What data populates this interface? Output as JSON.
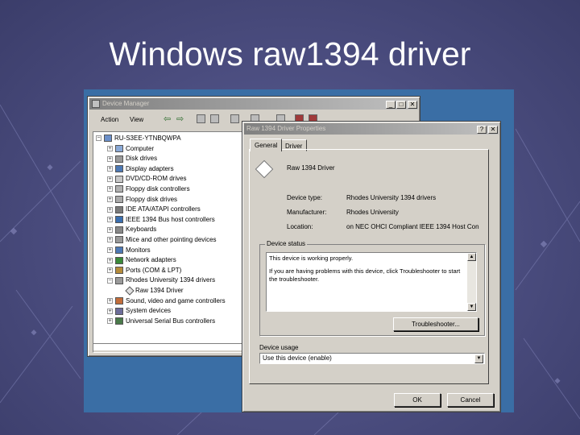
{
  "slide": {
    "title": "Windows raw1394 driver"
  },
  "device_manager": {
    "title": "Device Manager",
    "menus": [
      "Action",
      "View"
    ],
    "tree": [
      {
        "label": "RU-S3EE-YTNBQWPA",
        "level": 0,
        "icon": "computer-root-icon"
      },
      {
        "label": "Computer",
        "level": 1,
        "icon": "computer-icon"
      },
      {
        "label": "Disk drives",
        "level": 1,
        "icon": "disk-drive-icon"
      },
      {
        "label": "Display adapters",
        "level": 1,
        "icon": "display-adapter-icon"
      },
      {
        "label": "DVD/CD-ROM drives",
        "level": 1,
        "icon": "cdrom-icon"
      },
      {
        "label": "Floppy disk controllers",
        "level": 1,
        "icon": "floppy-controller-icon"
      },
      {
        "label": "Floppy disk drives",
        "level": 1,
        "icon": "floppy-drive-icon"
      },
      {
        "label": "IDE ATA/ATAPI controllers",
        "level": 1,
        "icon": "ide-controller-icon"
      },
      {
        "label": "IEEE 1394 Bus host controllers",
        "level": 1,
        "icon": "ieee1394-icon"
      },
      {
        "label": "Keyboards",
        "level": 1,
        "icon": "keyboard-icon"
      },
      {
        "label": "Mice and other pointing devices",
        "level": 1,
        "icon": "mouse-icon"
      },
      {
        "label": "Monitors",
        "level": 1,
        "icon": "monitor-icon"
      },
      {
        "label": "Network adapters",
        "level": 1,
        "icon": "network-adapter-icon"
      },
      {
        "label": "Ports (COM & LPT)",
        "level": 1,
        "icon": "port-icon"
      },
      {
        "label": "Rhodes University 1394 drivers",
        "level": 1,
        "icon": "driver-category-icon"
      },
      {
        "label": "Raw 1394 Driver",
        "level": 2,
        "icon": "raw-driver-icon"
      },
      {
        "label": "Sound, video and game controllers",
        "level": 1,
        "icon": "sound-icon"
      },
      {
        "label": "System devices",
        "level": 1,
        "icon": "system-devices-icon"
      },
      {
        "label": "Universal Serial Bus controllers",
        "level": 1,
        "icon": "usb-icon"
      }
    ]
  },
  "properties": {
    "title": "Raw 1394 Driver Properties",
    "help_glyph": "?",
    "close_glyph": "✕",
    "tabs": [
      "General",
      "Driver"
    ],
    "device_name": "Raw 1394 Driver",
    "fields": [
      {
        "label": "Device type:",
        "value": "Rhodes University 1394 drivers"
      },
      {
        "label": "Manufacturer:",
        "value": "Rhodes University"
      },
      {
        "label": "Location:",
        "value": "on NEC OHCI Compliant IEEE 1394 Host Con"
      }
    ],
    "status_group_label": "Device status",
    "status_text_1": "This device is working properly.",
    "status_text_2": "If you are having problems with this device, click Troubleshooter to start the troubleshooter.",
    "troubleshoot_label": "Troubleshooter...",
    "usage_label": "Device usage",
    "usage_value": "Use this device (enable)",
    "ok_label": "OK",
    "cancel_label": "Cancel"
  },
  "window_controls": {
    "minimize": "_",
    "maximize": "□",
    "close": "✕"
  }
}
